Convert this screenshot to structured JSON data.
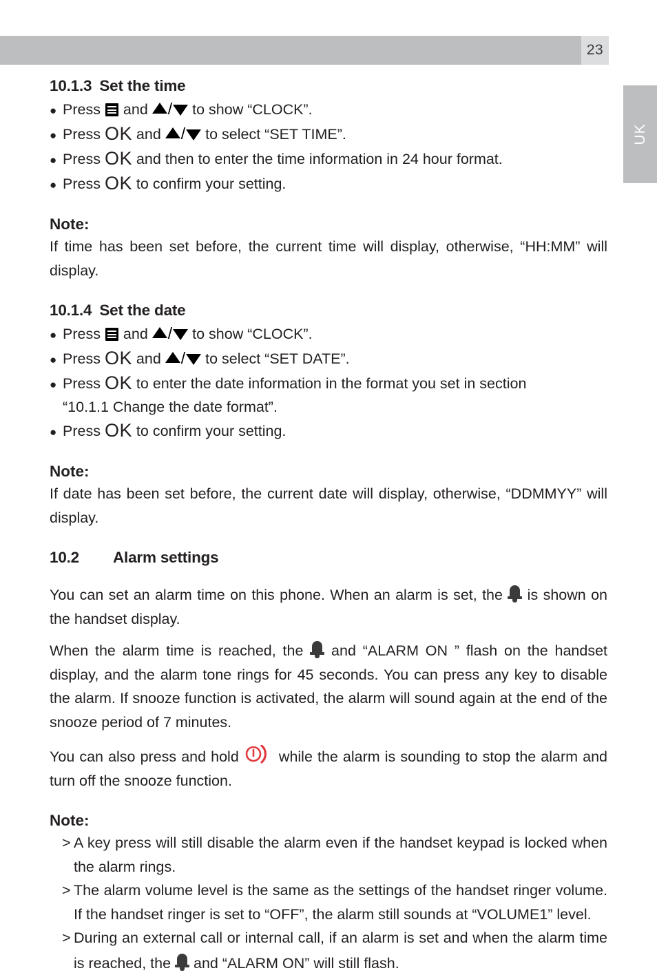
{
  "header": {
    "page_number": "23",
    "bar_color": "#bcbec0",
    "page_box_color": "#dcdddf"
  },
  "language_tab": {
    "label": "UK",
    "background": "#bcbec0",
    "text_color": "#ffffff"
  },
  "icons": {
    "menu": "menu-icon",
    "arrow_up": "triangle-up-icon",
    "arrow_down": "triangle-down-icon",
    "bell": "bell-icon",
    "power": "power-hangup-icon",
    "ok": "OK"
  },
  "sections": {
    "set_time": {
      "number": "10.1.3",
      "title": "Set the time",
      "bullets": [
        {
          "pre": "Press ",
          "icon": "menu",
          "mid": " and ",
          "arrows": true,
          "post": " to show “CLOCK”."
        },
        {
          "pre": "Press ",
          "ok": "OK",
          "mid": " and ",
          "arrows": true,
          "post": " to select “SET TIME”."
        },
        {
          "pre": "Press ",
          "ok": "OK",
          "post": " and then to enter the time information in 24 hour format."
        },
        {
          "pre": "Press ",
          "ok": "OK",
          "post": " to confirm your setting."
        }
      ]
    },
    "note_time": {
      "heading": "Note:",
      "body": "If time has been set before, the current time will display, otherwise, “HH:MM” will display."
    },
    "set_date": {
      "number": "10.1.4",
      "title": "Set the date",
      "bullets": [
        {
          "pre": "Press ",
          "icon": "menu",
          "mid": " and ",
          "arrows": true,
          "post": " to show “CLOCK”."
        },
        {
          "pre": "Press ",
          "ok": "OK",
          "mid": " and ",
          "arrows": true,
          "post": " to select “SET DATE”."
        },
        {
          "pre": "Press ",
          "ok": "OK",
          "post": " to enter the date information in the format you set in section",
          "continuation": "“10.1.1 Change the date format”."
        },
        {
          "pre": "Press ",
          "ok": "OK",
          "post": " to confirm your setting."
        }
      ]
    },
    "note_date": {
      "heading": "Note:",
      "body": "If date has been set before, the current date will display, otherwise, “DDMMYY” will display."
    },
    "alarm_settings": {
      "number": "10.2",
      "title": "Alarm settings",
      "para1_pre": "You can set an alarm time on this phone. When an alarm is set, the ",
      "para1_post": " is shown on the handset display.",
      "para2_pre": "When the alarm time is reached, the ",
      "para2_post": " and “ALARM ON ” flash on the handset display, and the alarm tone rings for 45 seconds. You can press any key to disable the alarm. If snooze function is activated, the alarm will sound again at the end of the snooze period of 7 minutes.",
      "para3_pre": "You can also press and hold ",
      "para3_post": " while the alarm is sounding to stop the alarm and turn off the snooze function."
    },
    "note_alarm": {
      "heading": "Note:",
      "items": [
        {
          "marker": ">",
          "text": "A key press will still disable the alarm even if the handset keypad is locked when the alarm rings."
        },
        {
          "marker": ">",
          "text": "The alarm volume level is the same as the settings of the handset ringer volume. If the handset ringer is set to “OFF”, the alarm still sounds at “VOLUME1” level."
        },
        {
          "marker": ">",
          "pre": "During an external call or internal call, if an alarm is set and when the alarm time is reached, the ",
          "post": " and “ALARM ON” will still flash."
        }
      ]
    }
  }
}
